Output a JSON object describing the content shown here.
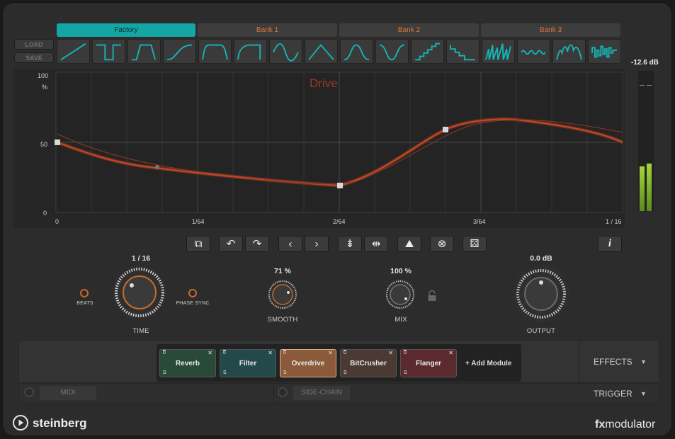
{
  "presets": {
    "load_label": "LOAD",
    "save_label": "SAVE"
  },
  "banks": [
    {
      "label": "Factory",
      "active": true
    },
    {
      "label": "Bank 1",
      "active": false
    },
    {
      "label": "Bank 2",
      "active": false
    },
    {
      "label": "Bank 3",
      "active": false
    }
  ],
  "shape_presets": [
    "ramp-up",
    "square",
    "trapezoid",
    "s-curve",
    "trapezoid-round",
    "plateau",
    "sine",
    "triangle",
    "bell",
    "inverted-bell",
    "stairs",
    "steps-down",
    "saw-burst",
    "wave-small",
    "bumps",
    "random-pulse"
  ],
  "graph": {
    "param_name": "Drive",
    "y_ticks": [
      "100",
      "50",
      "0"
    ],
    "y_unit": "%",
    "x_ticks": [
      "0",
      "1/64",
      "2/64",
      "3/64",
      "1 / 16"
    ]
  },
  "meter": {
    "readout": "-12.6 dB",
    "level_left": 0.32,
    "level_right": 0.34
  },
  "toolbar": {
    "items": [
      "copy-icon",
      "undo-icon",
      "redo-icon",
      "prev-icon",
      "next-icon",
      "compress-icon",
      "expand-icon",
      "invert-icon",
      "clear-icon",
      "random-icon"
    ],
    "info_label": "i"
  },
  "knobs": {
    "time": {
      "value": "1 / 16",
      "label": "TIME",
      "beats_label": "BEATS",
      "phase_sync_label": "PHASE SYNC"
    },
    "smooth": {
      "value": "71 %",
      "label": "SMOOTH"
    },
    "mix": {
      "value": "100 %",
      "label": "MIX"
    },
    "output": {
      "value": "0.0 dB",
      "label": "OUTPUT"
    }
  },
  "modules": [
    {
      "name": "Reverb",
      "color": "#2a4a38"
    },
    {
      "name": "Filter",
      "color": "#24494a"
    },
    {
      "name": "Overdrive",
      "color": "#8a5a3a"
    },
    {
      "name": "BitCrusher",
      "color": "#4a3a33"
    },
    {
      "name": "Flanger",
      "color": "#5a2a2e"
    }
  ],
  "add_module_label": "+ Add Module",
  "slot_marks": {
    "top": "0",
    "bottom": "S",
    "close": "✕"
  },
  "sections": {
    "effects": "EFFECTS",
    "trigger": "TRIGGER",
    "midi": "MIDI",
    "sidechain": "SIDE-CHAIN"
  },
  "footer": {
    "brand": "steinberg",
    "product_bold": "fx",
    "product_rest": "modulator"
  }
}
